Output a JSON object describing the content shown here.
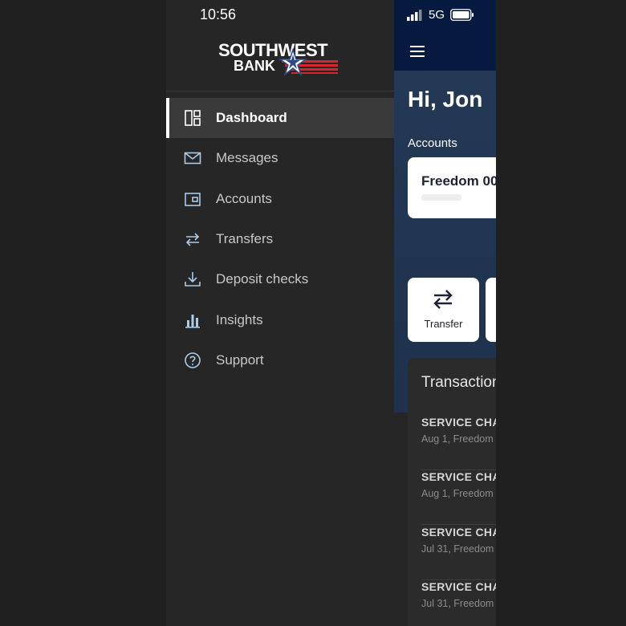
{
  "status_bar": {
    "time": "10:56",
    "network": "5G"
  },
  "drawer": {
    "logo": {
      "line1": "SOUTHWEST",
      "line2": "BANK"
    },
    "items": [
      {
        "label": "Dashboard",
        "icon": "dashboard-icon",
        "active": true
      },
      {
        "label": "Messages",
        "icon": "envelope-icon",
        "active": false
      },
      {
        "label": "Accounts",
        "icon": "wallet-icon",
        "active": false
      },
      {
        "label": "Transfers",
        "icon": "transfer-arrows-icon",
        "active": false
      },
      {
        "label": "Deposit checks",
        "icon": "download-icon",
        "active": false
      },
      {
        "label": "Insights",
        "icon": "bar-chart-icon",
        "active": false
      },
      {
        "label": "Support",
        "icon": "question-circle-icon",
        "active": false
      }
    ]
  },
  "main": {
    "greeting": "Hi, Jon",
    "accounts_heading": "Accounts",
    "account_card": {
      "name": "Freedom 00"
    },
    "quick_actions": [
      {
        "label": "Transfer",
        "icon": "transfer-arrows-icon"
      }
    ],
    "transactions": {
      "title": "Transactions",
      "rows": [
        {
          "description": "SERVICE CHA",
          "meta": "Aug 1, Freedom"
        },
        {
          "description": "SERVICE CHA",
          "meta": "Aug 1, Freedom"
        },
        {
          "description": "SERVICE CHA",
          "meta": "Jul 31, Freedom"
        },
        {
          "description": "SERVICE CHA",
          "meta": "Jul 31, Freedom"
        }
      ]
    }
  },
  "colors": {
    "header_navy": "#061a40",
    "hero_blue": "#233955",
    "drawer_bg": "#262626",
    "active_item_bg": "#3a3a3a",
    "brand_red": "#d9262e",
    "icon_blue": "#a9cce8"
  }
}
